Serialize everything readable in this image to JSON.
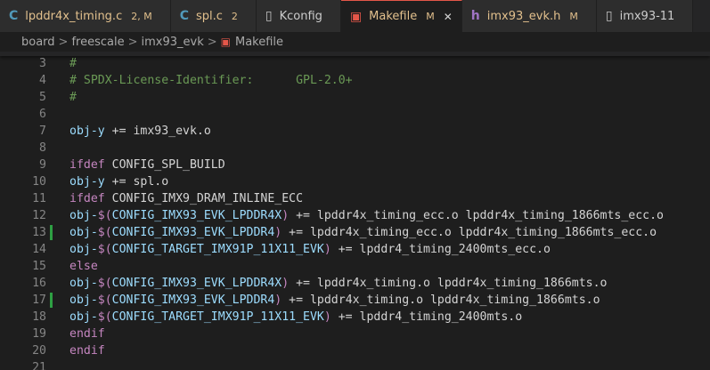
{
  "tabs": [
    {
      "icon": "c-file-icon",
      "glyph": "C",
      "icon_class": "ic-c",
      "label": "lpddr4x_timing.c",
      "status": "2, M",
      "status_color": "#e2c08d",
      "label_color": "#e2c08d",
      "close": "",
      "active": false
    },
    {
      "icon": "c-file-icon",
      "glyph": "C",
      "icon_class": "ic-c",
      "label": "spl.c",
      "status": "2",
      "status_color": "#e2c08d",
      "label_color": "#e2c08d",
      "close": "",
      "active": false
    },
    {
      "icon": "file-icon",
      "glyph": "▯",
      "icon_class": "ic-file",
      "label": "Kconfig",
      "status": "",
      "status_color": "#cccccc",
      "label_color": "#cccccc",
      "close": "",
      "active": false
    },
    {
      "icon": "makefile-icon",
      "glyph": "▣",
      "icon_class": "ic-make",
      "label": "Makefile",
      "status": "M",
      "status_color": "#e2c08d",
      "label_color": "#e2c08d",
      "close": "✕",
      "active": true
    },
    {
      "icon": "h-file-icon",
      "glyph": "h",
      "icon_class": "ic-h",
      "label": "imx93_evk.h",
      "status": "M",
      "status_color": "#e2c08d",
      "label_color": "#e2c08d",
      "close": "",
      "active": false
    },
    {
      "icon": "file-icon",
      "glyph": "▯",
      "icon_class": "ic-file",
      "label": "imx93-11",
      "status": "",
      "status_color": "#cccccc",
      "label_color": "#cccccc",
      "close": "",
      "active": false
    }
  ],
  "breadcrumb": {
    "parts": [
      "board",
      "freescale",
      "imx93_evk"
    ],
    "file": "Makefile",
    "separator": ">"
  },
  "colors": {
    "comment": "#6a9955",
    "variable": "#9cdcfe",
    "keyword": "#c586c0",
    "plain": "#d4d4d4",
    "brace": "#ffd700",
    "git_modified": "#2ea043"
  },
  "lines": [
    {
      "n": "3",
      "git": false,
      "tokens": [
        {
          "t": "#",
          "c": "tok-comment"
        }
      ]
    },
    {
      "n": "4",
      "git": false,
      "tokens": [
        {
          "t": "# SPDX-License-Identifier:      GPL-2.0+",
          "c": "tok-comment"
        }
      ]
    },
    {
      "n": "5",
      "git": false,
      "tokens": [
        {
          "t": "#",
          "c": "tok-comment"
        }
      ]
    },
    {
      "n": "6",
      "git": false,
      "tokens": []
    },
    {
      "n": "7",
      "git": false,
      "tokens": [
        {
          "t": "obj-y",
          "c": "tok-var"
        },
        {
          "t": " += imx93_evk.o",
          "c": "tok-plain"
        }
      ]
    },
    {
      "n": "8",
      "git": false,
      "tokens": []
    },
    {
      "n": "9",
      "git": false,
      "tokens": [
        {
          "t": "ifdef",
          "c": "tok-kw"
        },
        {
          "t": " CONFIG_SPL_BUILD",
          "c": "tok-plain"
        }
      ]
    },
    {
      "n": "10",
      "git": false,
      "tokens": [
        {
          "t": "obj-y",
          "c": "tok-var"
        },
        {
          "t": " += spl.o",
          "c": "tok-plain"
        }
      ]
    },
    {
      "n": "11",
      "git": false,
      "tokens": [
        {
          "t": "ifdef",
          "c": "tok-kw"
        },
        {
          "t": " CONFIG_IMX9_DRAM_INLINE_ECC",
          "c": "tok-plain"
        }
      ]
    },
    {
      "n": "12",
      "git": false,
      "tokens": [
        {
          "t": "obj-",
          "c": "tok-var"
        },
        {
          "t": "$(",
          "c": "tok-kw"
        },
        {
          "t": "CONFIG_IMX93_EVK_LPDDR4X",
          "c": "tok-var"
        },
        {
          "t": ")",
          "c": "tok-kw"
        },
        {
          "t": " += lpddr4x_timing_ecc.o lpddr4x_timing_1866mts_ecc.o",
          "c": "tok-plain"
        }
      ]
    },
    {
      "n": "13",
      "git": true,
      "tokens": [
        {
          "t": "obj-",
          "c": "tok-var"
        },
        {
          "t": "$(",
          "c": "tok-kw"
        },
        {
          "t": "CONFIG_IMX93_EVK_LPDDR4",
          "c": "tok-var"
        },
        {
          "t": ")",
          "c": "tok-kw"
        },
        {
          "t": " += lpddr4x_timing_ecc.o lpddr4x_timing_1866mts_ecc.o",
          "c": "tok-plain"
        }
      ]
    },
    {
      "n": "14",
      "git": false,
      "tokens": [
        {
          "t": "obj-",
          "c": "tok-var"
        },
        {
          "t": "$(",
          "c": "tok-kw"
        },
        {
          "t": "CONFIG_TARGET_IMX91P_11X11_EVK",
          "c": "tok-var"
        },
        {
          "t": ")",
          "c": "tok-kw"
        },
        {
          "t": " += lpddr4_timing_2400mts_ecc.o",
          "c": "tok-plain"
        }
      ]
    },
    {
      "n": "15",
      "git": false,
      "tokens": [
        {
          "t": "else",
          "c": "tok-kw"
        }
      ]
    },
    {
      "n": "16",
      "git": false,
      "tokens": [
        {
          "t": "obj-",
          "c": "tok-var"
        },
        {
          "t": "$(",
          "c": "tok-kw"
        },
        {
          "t": "CONFIG_IMX93_EVK_LPDDR4X",
          "c": "tok-var"
        },
        {
          "t": ")",
          "c": "tok-kw"
        },
        {
          "t": " += lpddr4x_timing.o lpddr4x_timing_1866mts.o",
          "c": "tok-plain"
        }
      ]
    },
    {
      "n": "17",
      "git": true,
      "tokens": [
        {
          "t": "obj-",
          "c": "tok-var"
        },
        {
          "t": "$(",
          "c": "tok-kw"
        },
        {
          "t": "CONFIG_IMX93_EVK_LPDDR4",
          "c": "tok-var"
        },
        {
          "t": ")",
          "c": "tok-kw"
        },
        {
          "t": " += lpddr4x_timing.o lpddr4x_timing_1866mts.o",
          "c": "tok-plain"
        }
      ]
    },
    {
      "n": "18",
      "git": false,
      "tokens": [
        {
          "t": "obj-",
          "c": "tok-var"
        },
        {
          "t": "$(",
          "c": "tok-kw"
        },
        {
          "t": "CONFIG_TARGET_IMX91P_11X11_EVK",
          "c": "tok-var"
        },
        {
          "t": ")",
          "c": "tok-kw"
        },
        {
          "t": " += lpddr4_timing_2400mts.o",
          "c": "tok-plain"
        }
      ]
    },
    {
      "n": "19",
      "git": false,
      "tokens": [
        {
          "t": "endif",
          "c": "tok-kw"
        }
      ]
    },
    {
      "n": "20",
      "git": false,
      "tokens": [
        {
          "t": "endif",
          "c": "tok-kw"
        }
      ]
    },
    {
      "n": "21",
      "git": false,
      "tokens": []
    }
  ]
}
